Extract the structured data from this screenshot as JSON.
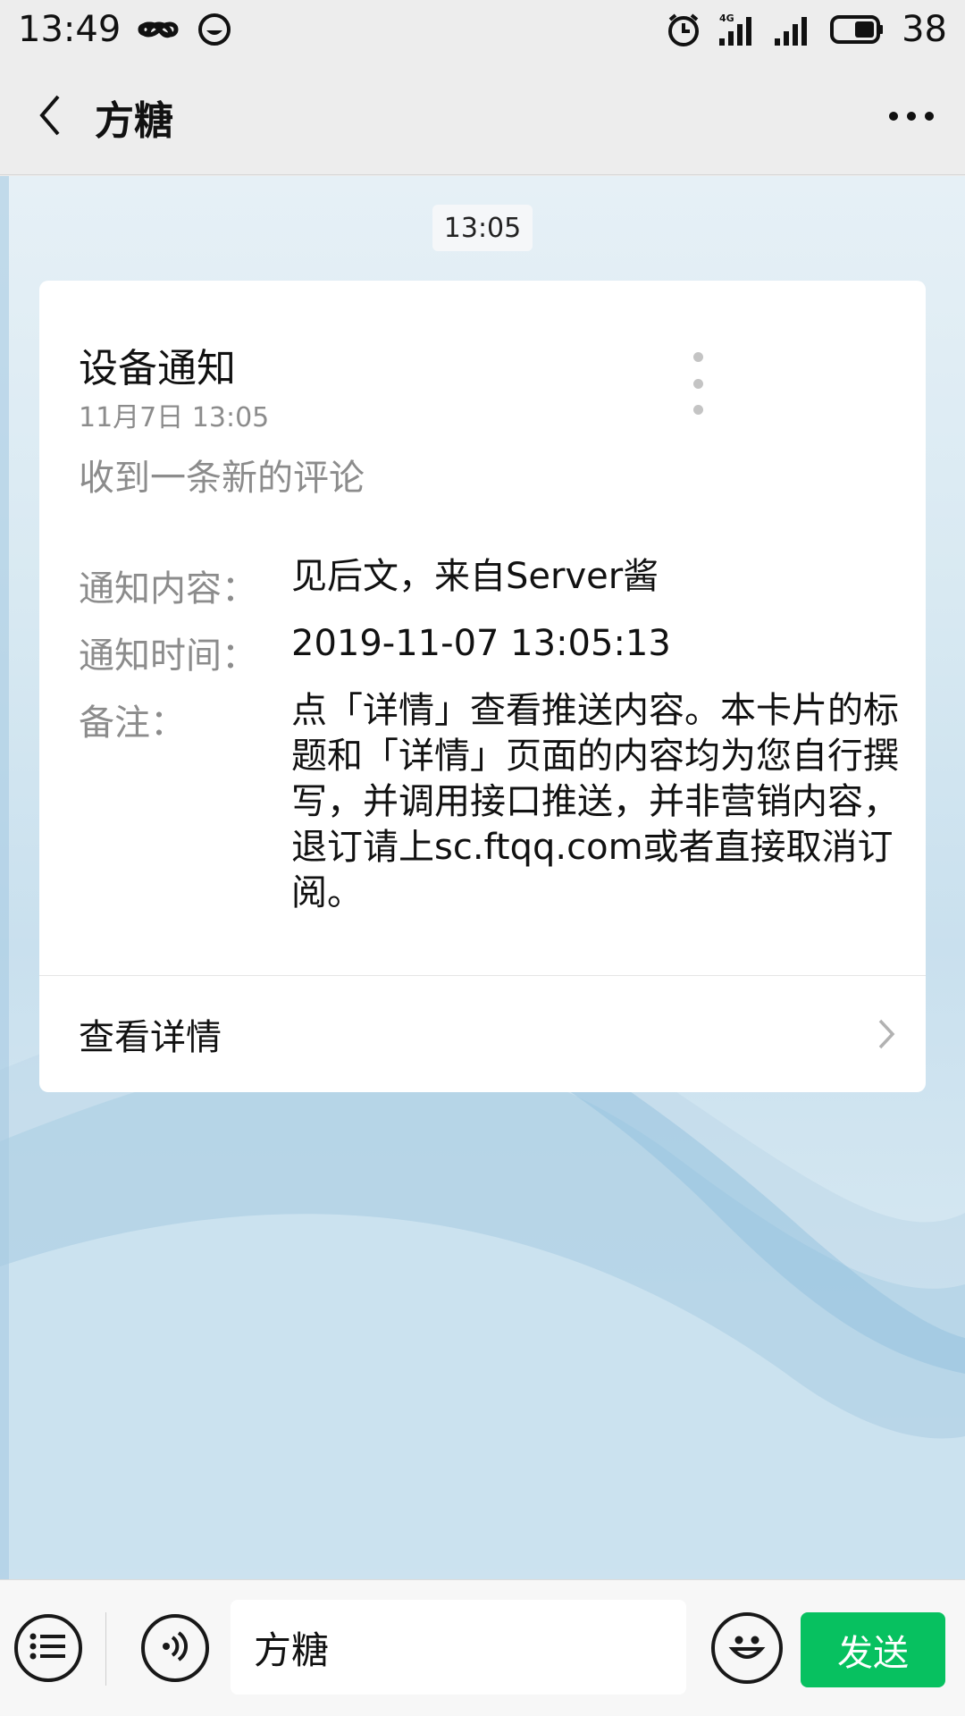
{
  "status_bar": {
    "time": "13:49",
    "left_icons": [
      "infinity-icon",
      "messenger-icon"
    ],
    "right_icons": [
      "alarm-icon",
      "signal-4g-icon",
      "signal-icon",
      "battery-icon"
    ],
    "network_label": "4G",
    "battery": "38"
  },
  "nav": {
    "title": "方糖",
    "back_icon": "back-chevron-icon",
    "more_icon": "more-dots-icon"
  },
  "chat": {
    "timestamp": "13:05",
    "card": {
      "title": "设备通知",
      "date": "11月7日  13:05",
      "subtitle": "收到一条新的评论",
      "fields": [
        {
          "label": "通知内容：",
          "value": "见后文，来自Server酱"
        },
        {
          "label": "通知时间：",
          "value": "2019-11-07 13:05:13"
        },
        {
          "label": "备注：",
          "value": "点「详情」查看推送内容。本卡片的标题和「详情」页面的内容均为您自行撰写，并调用接口推送，并非营销内容，退订请上sc.ftqq.com或者直接取消订阅。"
        }
      ],
      "detail_label": "查看详情"
    }
  },
  "input_bar": {
    "menu_icon": "menu-list-icon",
    "voice_icon": "voice-icon",
    "input_value": "方糖",
    "emoji_icon": "emoji-icon",
    "send_label": "发送"
  },
  "colors": {
    "send_button": "#07c160",
    "background": "#ededed",
    "card": "#ffffff",
    "secondary_text": "#8c8c8c"
  }
}
